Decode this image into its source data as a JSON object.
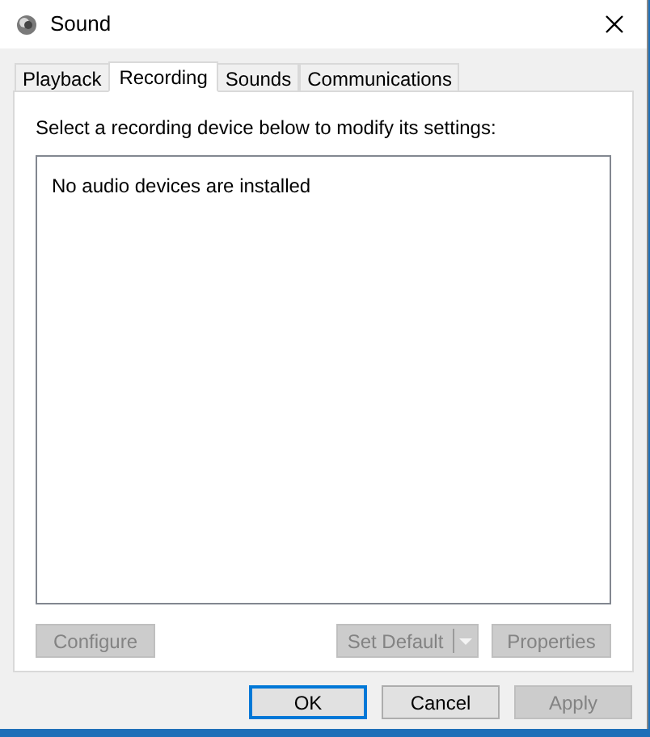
{
  "window": {
    "title": "Sound"
  },
  "tabs": [
    {
      "label": "Playback",
      "selected": false
    },
    {
      "label": "Recording",
      "selected": true
    },
    {
      "label": "Sounds",
      "selected": false
    },
    {
      "label": "Communications",
      "selected": false
    }
  ],
  "instruction": "Select a recording device below to modify its settings:",
  "device_list": {
    "empty_message": "No audio devices are installed"
  },
  "device_buttons": [
    {
      "label": "Configure",
      "disabled": true,
      "kind": "plain"
    },
    {
      "label": "Set Default",
      "disabled": true,
      "kind": "split"
    },
    {
      "label": "Properties",
      "disabled": true,
      "kind": "plain"
    }
  ],
  "dialog_buttons": [
    {
      "label": "OK",
      "disabled": false,
      "default": true
    },
    {
      "label": "Cancel",
      "disabled": false,
      "default": false
    },
    {
      "label": "Apply",
      "disabled": true,
      "default": false
    }
  ]
}
